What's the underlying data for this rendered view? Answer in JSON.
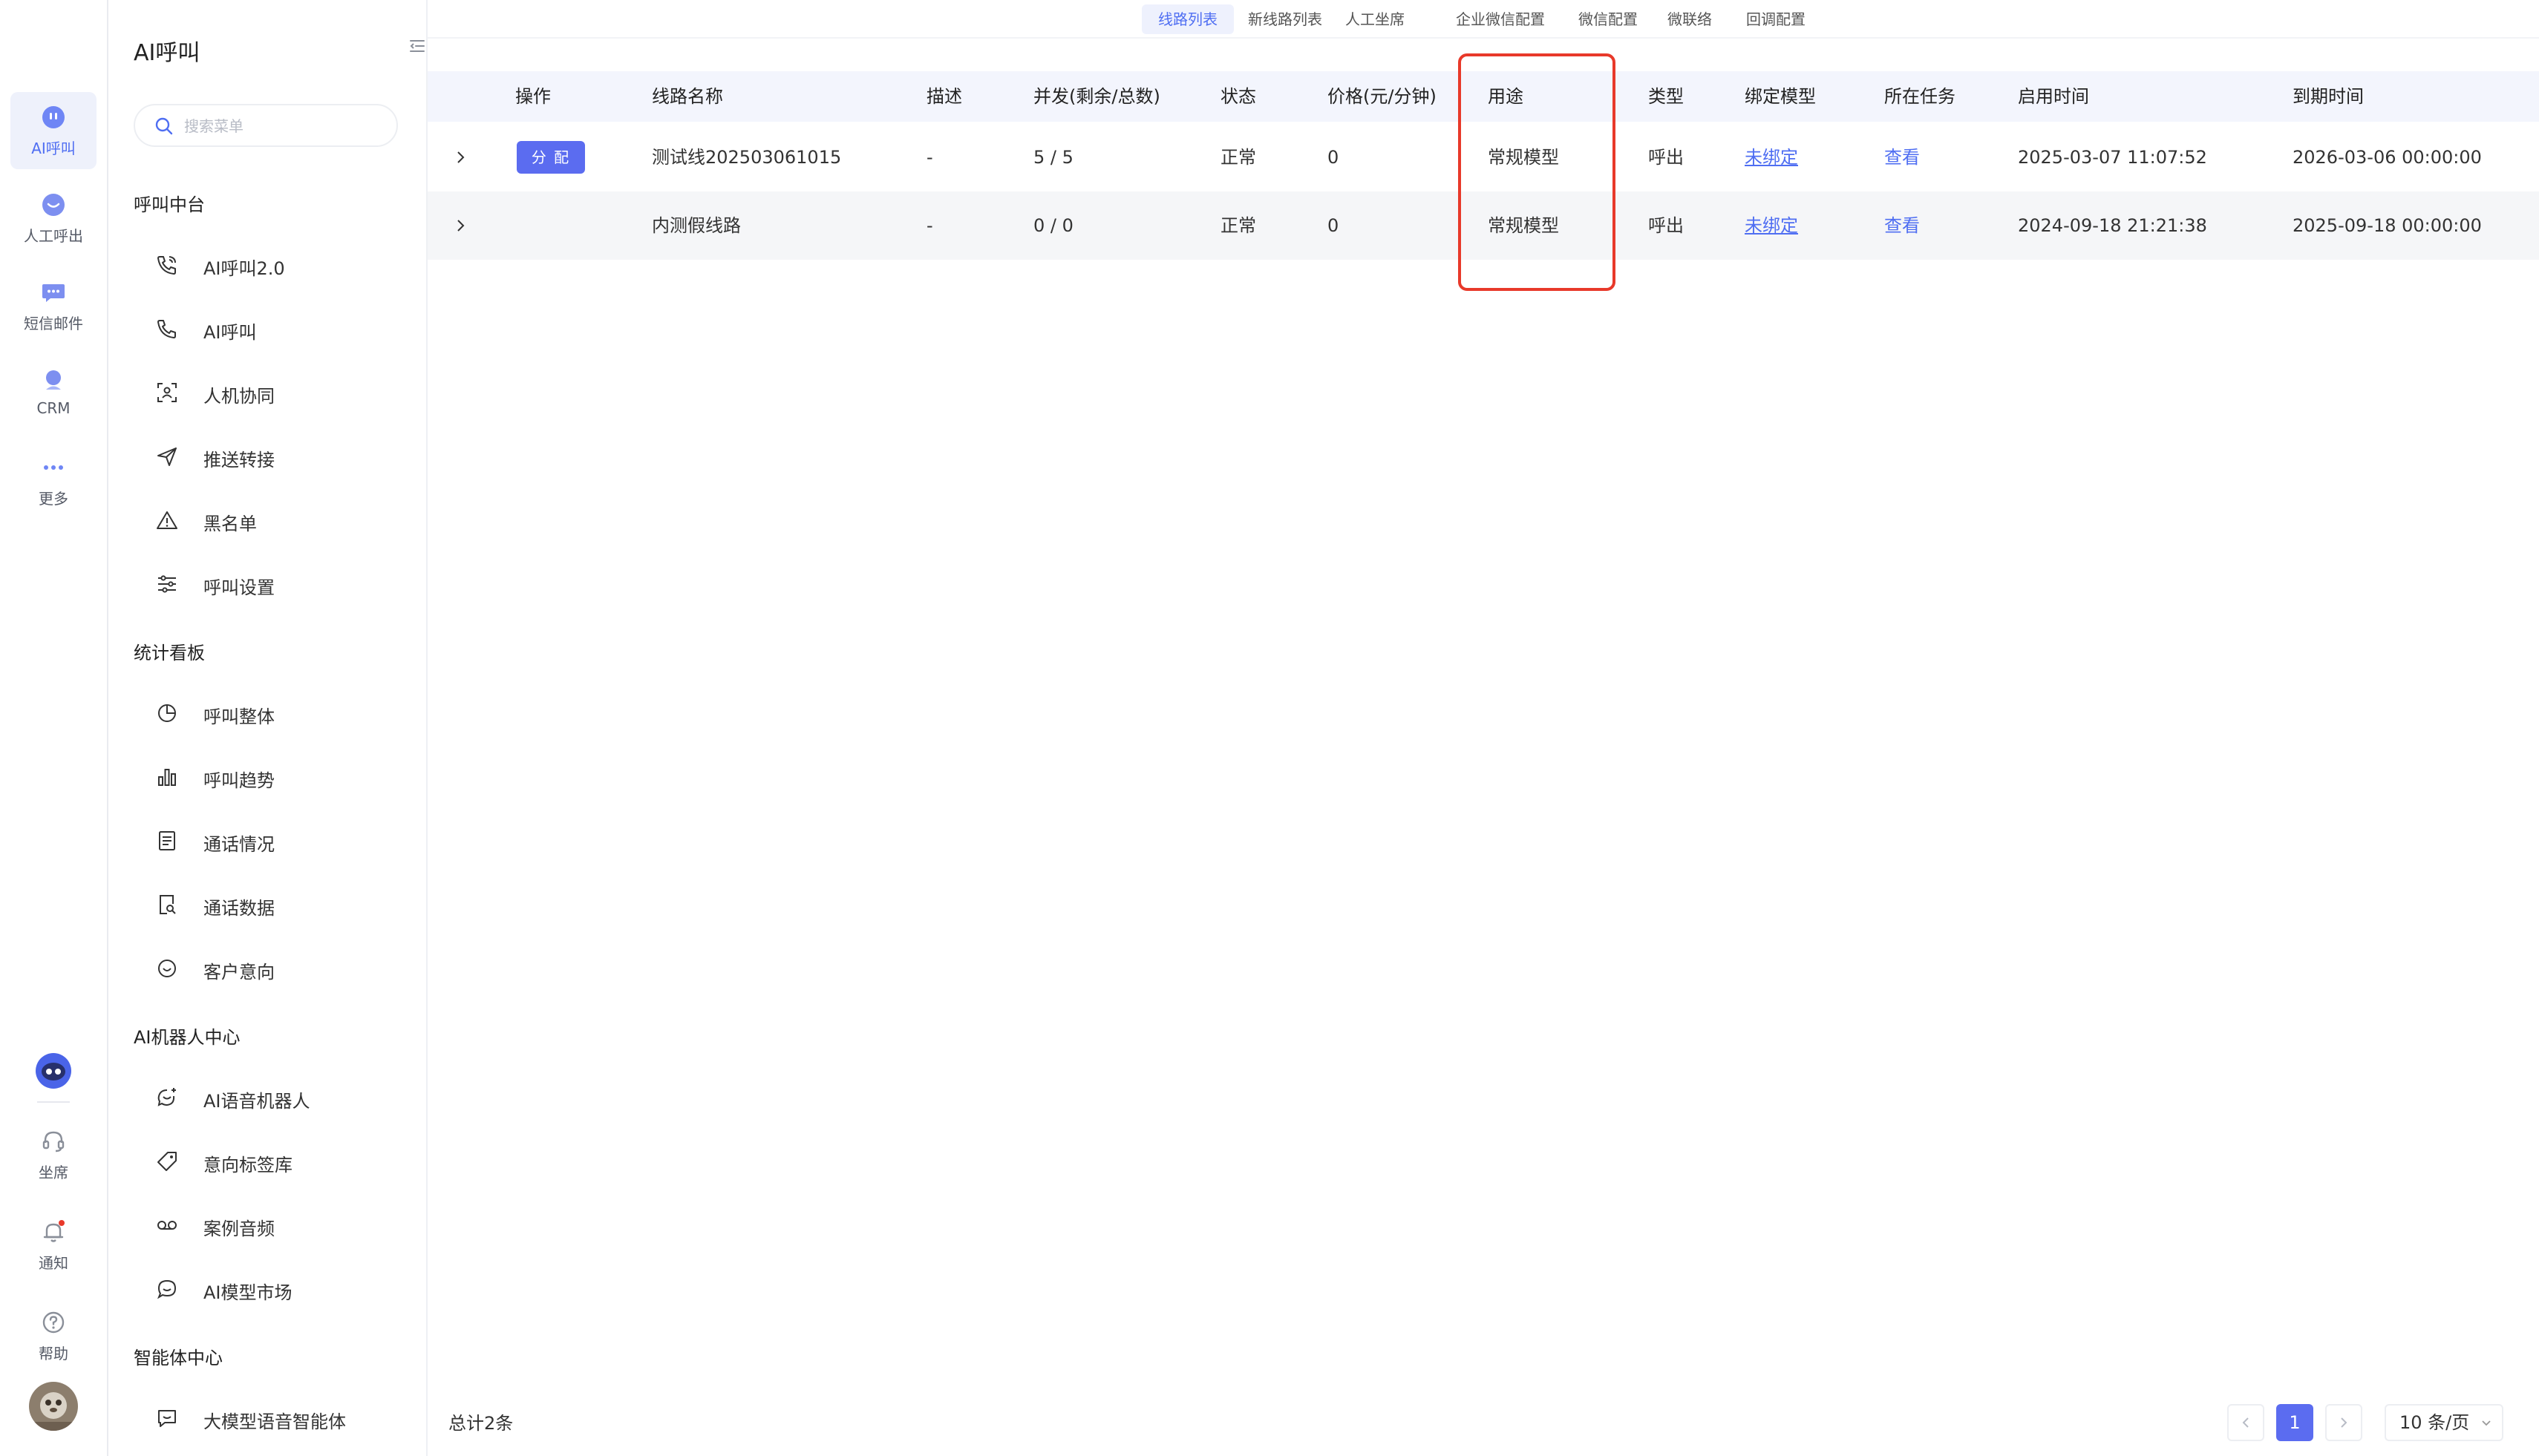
{
  "rail": {
    "items": [
      {
        "label": "AI呼叫",
        "icon": "ai-call-icon",
        "active": true
      },
      {
        "label": "人工呼出",
        "icon": "manual-call-icon",
        "active": false
      },
      {
        "label": "短信邮件",
        "icon": "sms-mail-icon",
        "active": false
      },
      {
        "label": "CRM",
        "icon": "crm-icon",
        "active": false
      },
      {
        "label": "更多",
        "icon": "more-icon",
        "active": false
      }
    ],
    "bottom": [
      {
        "label": "坐席",
        "icon": "headset-icon"
      },
      {
        "label": "通知",
        "icon": "bell-icon"
      },
      {
        "label": "帮助",
        "icon": "help-icon"
      }
    ],
    "accent": "#4f6ef2",
    "notification_dot_color": "#e8392a"
  },
  "menu": {
    "title": "AI呼叫",
    "search_placeholder": "搜索菜单",
    "groups": [
      {
        "title": "呼叫中台",
        "items": [
          {
            "label": "AI呼叫2.0",
            "icon": "phone-wave-icon"
          },
          {
            "label": "AI呼叫",
            "icon": "phone-icon"
          },
          {
            "label": "人机协同",
            "icon": "scan-person-icon"
          },
          {
            "label": "推送转接",
            "icon": "send-icon"
          },
          {
            "label": "黑名单",
            "icon": "warning-icon"
          },
          {
            "label": "呼叫设置",
            "icon": "sliders-icon"
          }
        ]
      },
      {
        "title": "统计看板",
        "items": [
          {
            "label": "呼叫整体",
            "icon": "pie-chart-icon"
          },
          {
            "label": "呼叫趋势",
            "icon": "bar-chart-icon"
          },
          {
            "label": "通话情况",
            "icon": "document-icon"
          },
          {
            "label": "通话数据",
            "icon": "document-search-icon"
          },
          {
            "label": "客户意向",
            "icon": "smile-icon"
          }
        ]
      },
      {
        "title": "AI机器人中心",
        "items": [
          {
            "label": "AI语音机器人",
            "icon": "chat-spark-icon"
          },
          {
            "label": "意向标签库",
            "icon": "tag-icon"
          },
          {
            "label": "案例音频",
            "icon": "voicemail-icon"
          },
          {
            "label": "AI模型市场",
            "icon": "chat-bubble-icon"
          }
        ]
      },
      {
        "title": "智能体中心",
        "items": [
          {
            "label": "大模型语音智能体",
            "icon": "message-box-icon"
          }
        ]
      }
    ]
  },
  "tabs": [
    {
      "label": "线路列表",
      "active": true
    },
    {
      "label": "新线路列表",
      "active": false
    },
    {
      "label": "人工坐席",
      "active": false
    },
    {
      "label": "企业微信配置",
      "active": false
    },
    {
      "label": "微信配置",
      "active": false
    },
    {
      "label": "微联络",
      "active": false
    },
    {
      "label": "回调配置",
      "active": false
    }
  ],
  "table": {
    "columns": [
      "操作",
      "线路名称",
      "描述",
      "并发(剩余/总数)",
      "状态",
      "价格(元/分钟)",
      "用途",
      "类型",
      "绑定模型",
      "所在任务",
      "启用时间",
      "到期时间"
    ],
    "assign_label": "分 配",
    "rows": [
      {
        "name": "测试线202503061015",
        "desc": "-",
        "concurrency": "5 / 5",
        "status": "正常",
        "price": "0",
        "usage": "常规模型",
        "type": "呼出",
        "model": "未绑定",
        "task": "查看",
        "start": "2025-03-07 11:07:52",
        "end": "2026-03-06 00:00:00",
        "has_assign": true
      },
      {
        "name": "内测假线路",
        "desc": "-",
        "concurrency": "0 / 0",
        "status": "正常",
        "price": "0",
        "usage": "常规模型",
        "type": "呼出",
        "model": "未绑定",
        "task": "查看",
        "start": "2024-09-18 21:21:38",
        "end": "2025-09-18 00:00:00",
        "has_assign": false
      }
    ],
    "highlight_color": "#e8392a"
  },
  "footer": {
    "total": "总计2条",
    "current_page": "1",
    "page_size": "10 条/页"
  }
}
